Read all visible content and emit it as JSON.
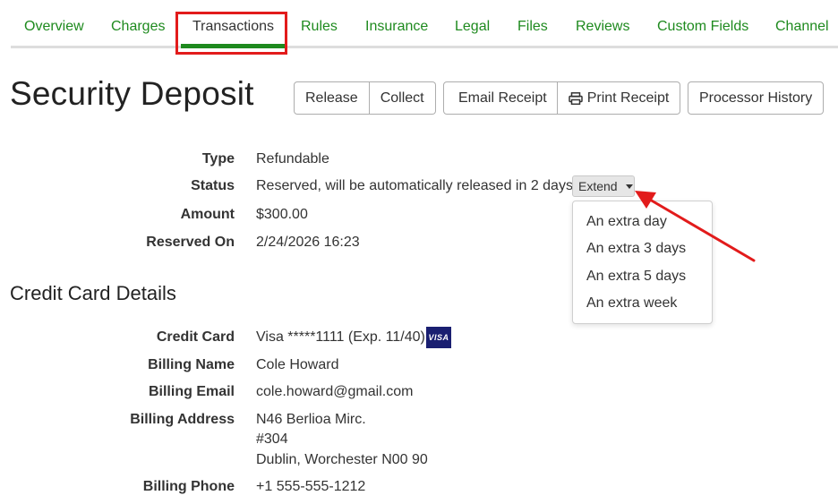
{
  "tabs": [
    {
      "label": "Overview"
    },
    {
      "label": "Charges"
    },
    {
      "label": "Transactions"
    },
    {
      "label": "Rules"
    },
    {
      "label": "Insurance"
    },
    {
      "label": "Legal"
    },
    {
      "label": "Files"
    },
    {
      "label": "Reviews"
    },
    {
      "label": "Custom Fields"
    },
    {
      "label": "Channel"
    }
  ],
  "active_tab": "Transactions",
  "page_title": "Security Deposit",
  "buttons": {
    "release": "Release",
    "collect": "Collect",
    "email_receipt": "Email Receipt",
    "print_receipt": "Print Receipt",
    "processor_history": "Processor History"
  },
  "details": {
    "type_label": "Type",
    "type_value": "Refundable",
    "status_label": "Status",
    "status_value": "Reserved, will be automatically released in 2 days",
    "extend_label": "Extend",
    "amount_label": "Amount",
    "amount_value": "$300.00",
    "reserved_on_label": "Reserved On",
    "reserved_on_value": "2/24/2026 16:23"
  },
  "extend_options": [
    "An extra day",
    "An extra 3 days",
    "An extra 5 days",
    "An extra week"
  ],
  "credit_card": {
    "section_title": "Credit Card Details",
    "card_label": "Credit Card",
    "card_value": "Visa *****1111 (Exp. 11/40)",
    "card_brand": "VISA",
    "billing_name_label": "Billing Name",
    "billing_name_value": "Cole Howard",
    "billing_email_label": "Billing Email",
    "billing_email_value": "cole.howard@gmail.com",
    "billing_address_label": "Billing Address",
    "billing_address_lines": [
      "N46 Berlioa Mirc.",
      "#304",
      "Dublin, Worchester N00 90"
    ],
    "billing_phone_label": "Billing Phone",
    "billing_phone_value": "+1 555-555-1212"
  },
  "colors": {
    "tab_green": "#1e8a1e",
    "annotation_red": "#e21b1b",
    "visa_blue": "#1a1f71"
  },
  "icons": [
    "printer-icon",
    "caret-down-icon",
    "visa-logo-icon",
    "annotation-arrow"
  ]
}
